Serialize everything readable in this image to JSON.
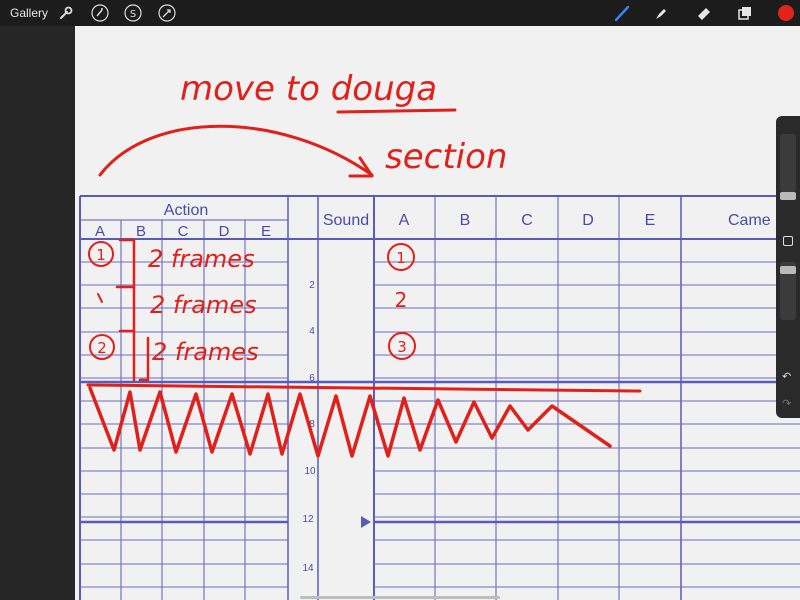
{
  "toolbar": {
    "gallery_label": "Gallery",
    "left_icons": [
      "wrench-icon",
      "magic-wand-icon",
      "selection-s-icon",
      "transform-arrow-icon"
    ],
    "right_icons": [
      "brush-icon",
      "smudge-icon",
      "eraser-icon",
      "layers-icon",
      "color-icon"
    ],
    "active_color": "#e3231a"
  },
  "sheet": {
    "action_header": "Action",
    "action_columns": [
      "A",
      "B",
      "C",
      "D",
      "E"
    ],
    "sound_header": "Sound",
    "dialogue_columns": [
      "A",
      "B",
      "C",
      "D",
      "E"
    ],
    "camera_header": "Came",
    "frame_numbers": [
      "2",
      "4",
      "6",
      "8",
      "10",
      "12",
      "14"
    ],
    "line_color": "#5555b5"
  },
  "annotations": {
    "title_line1": "move to douga",
    "title_line2": "section",
    "rows_left": [
      {
        "marker": "1",
        "text": "2 frames"
      },
      {
        "marker": "",
        "text": "2 frames"
      },
      {
        "marker": "2",
        "text": "2 frames"
      }
    ],
    "rows_right": [
      "1",
      "2",
      "3"
    ],
    "ink_color": "#e0201a"
  }
}
